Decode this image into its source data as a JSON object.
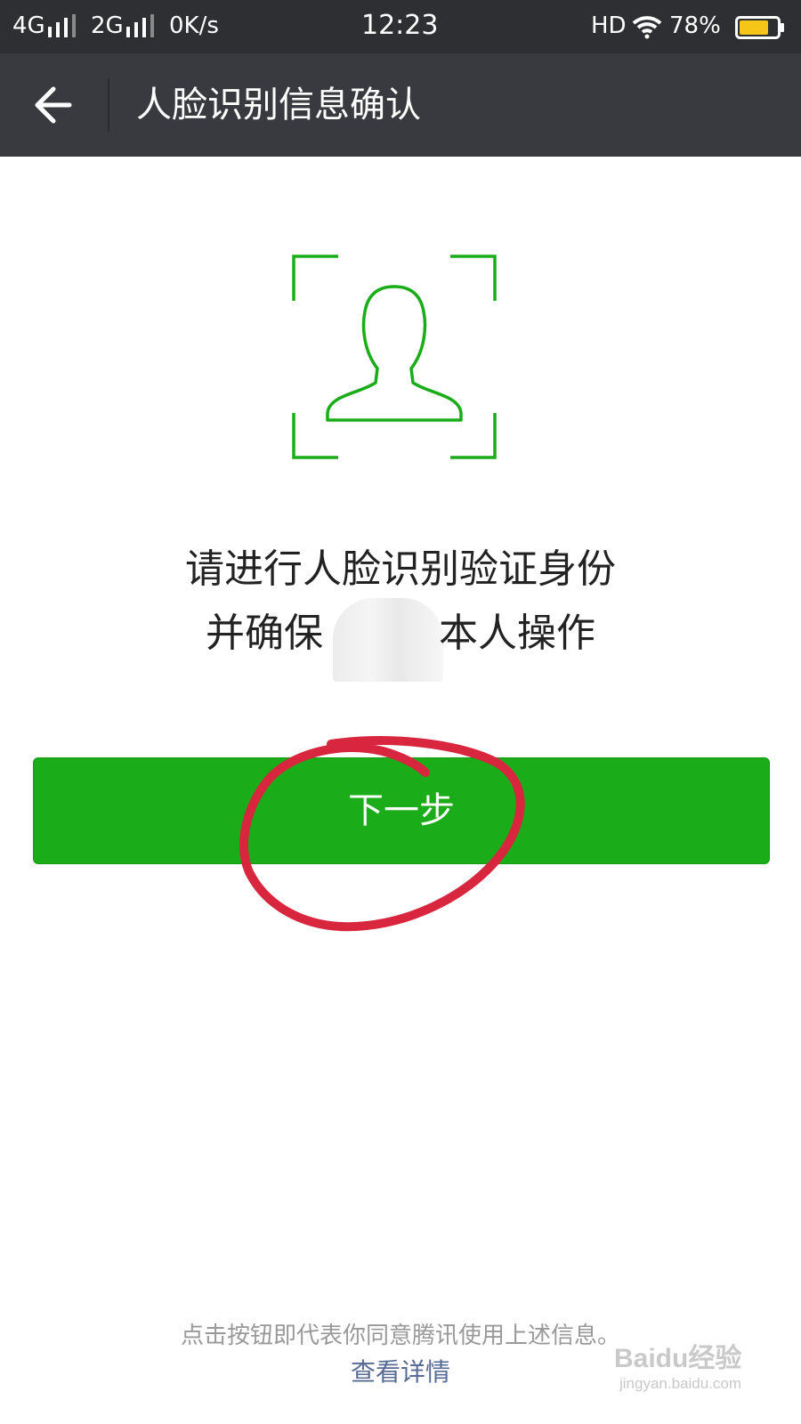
{
  "status_bar": {
    "net1": "4G",
    "net2": "2G",
    "speed": "0K/s",
    "time": "12:23",
    "hd": "HD",
    "battery": "78%",
    "battery_level": 0.78,
    "battery_color": "#f5c518"
  },
  "header": {
    "title": "人脸识别信息确认",
    "back_icon": "arrow-left-icon"
  },
  "main": {
    "face_icon": "face-recognition-icon",
    "accent_color": "#1aad19",
    "line1": "请进行人脸识别验证身份",
    "line2_before": "并确保",
    "line2_after": "本人操作",
    "next_button": "下一步"
  },
  "footer": {
    "agree_text": "点击按钮即代表你同意腾讯使用上述信息。",
    "details_link": "查看详情",
    "link_color": "#576b95"
  },
  "watermark": {
    "brand": "Baidu经验",
    "url": "jingyan.baidu.com"
  },
  "annotation": {
    "circle_color": "#d7263d"
  }
}
